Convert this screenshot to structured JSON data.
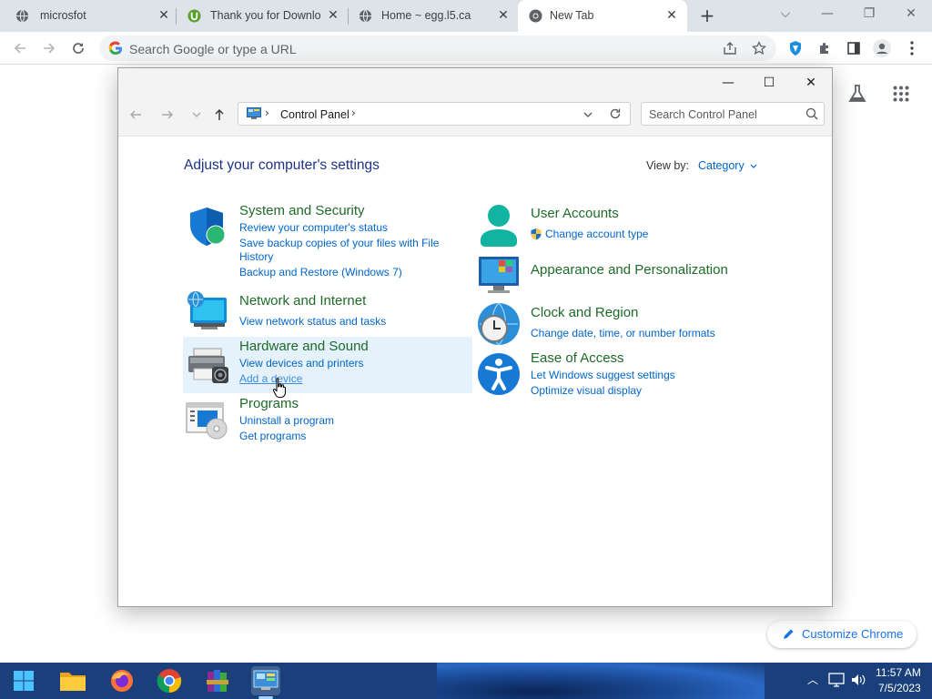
{
  "browser": {
    "tabs": [
      {
        "title": "microsfot"
      },
      {
        "title": "Thank you for Downlo"
      },
      {
        "title": "Home ~ egg.l5.ca"
      },
      {
        "title": "New Tab"
      }
    ],
    "omnibox_placeholder": "Search Google or type a URL",
    "customize_label": "Customize Chrome"
  },
  "control_panel": {
    "breadcrumb": "Control Panel",
    "search_placeholder": "Search Control Panel",
    "heading": "Adjust your computer's settings",
    "view_by_label": "View by:",
    "view_by_value": "Category",
    "categories": {
      "system": {
        "title": "System and Security",
        "links": [
          "Review your computer's status",
          "Save backup copies of your files with File",
          "History",
          "Backup and Restore (Windows 7)"
        ]
      },
      "network": {
        "title": "Network and Internet",
        "links": [
          "View network status and tasks"
        ]
      },
      "hardware": {
        "title": "Hardware and Sound",
        "links": [
          "View devices and printers",
          "Add a device"
        ]
      },
      "programs": {
        "title": "Programs",
        "links": [
          "Uninstall a program",
          "Get programs"
        ]
      },
      "users": {
        "title": "User Accounts",
        "links": [
          "Change account type"
        ]
      },
      "appearance": {
        "title": "Appearance and Personalization",
        "links": []
      },
      "clock": {
        "title": "Clock and Region",
        "links": [
          "Change date, time, or number formats"
        ]
      },
      "ease": {
        "title": "Ease of Access",
        "links": [
          "Let Windows suggest settings",
          "Optimize visual display"
        ]
      }
    }
  },
  "taskbar": {
    "time": "11:57 AM",
    "date": "7/5/2023"
  },
  "colors": {
    "category_title": "#1e6b28",
    "link": "#0066cc",
    "heading": "#1e3287",
    "chrome_accent": "#1a73e8"
  }
}
